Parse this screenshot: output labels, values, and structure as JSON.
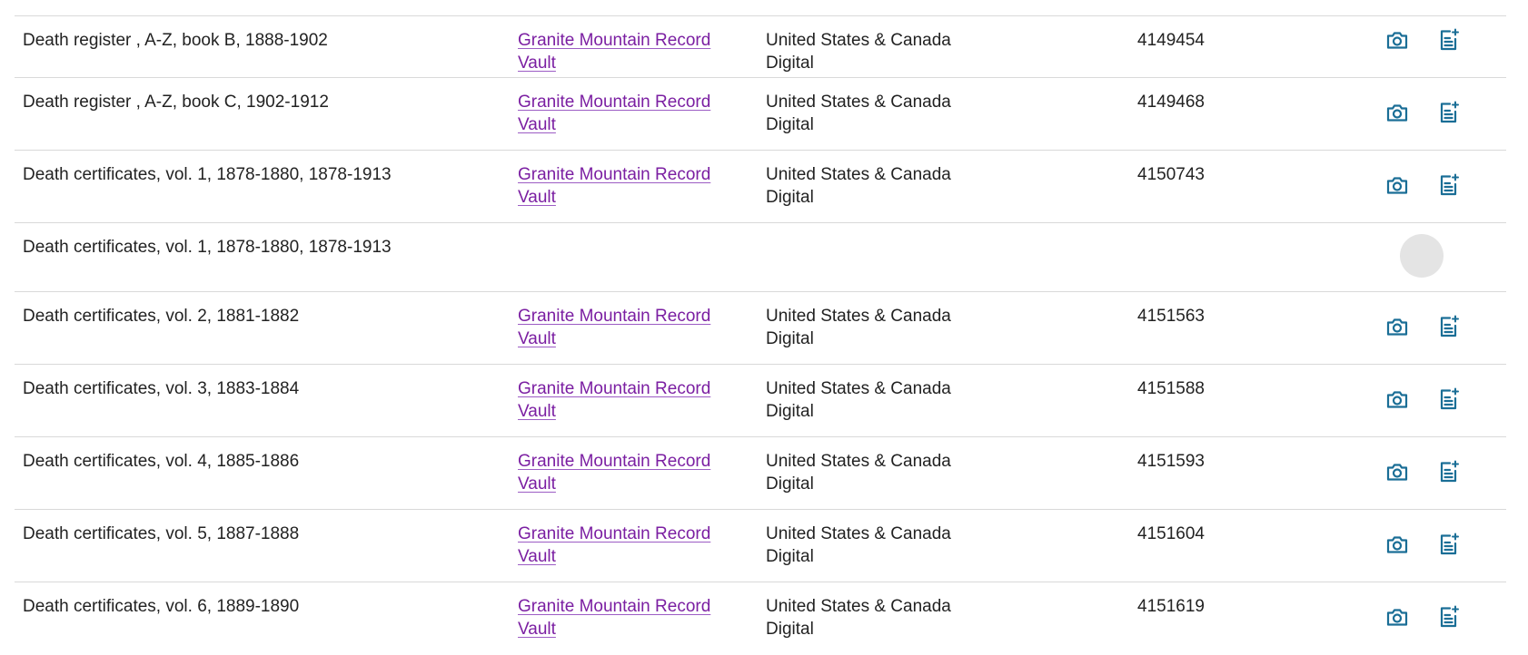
{
  "colors": {
    "link": "#7b1fa2",
    "icon": "#1a6e96",
    "divider": "#d9d9d9",
    "loading": "#e4e4e4"
  },
  "rows": [
    {
      "title": "Death register , A-Z, book B, 1888-1902",
      "location_line1": "Granite Mountain Record",
      "location_line2": "Vault",
      "region_line1": "United States & Canada",
      "region_line2": "Digital",
      "film": "4149454",
      "icons": [
        "camera-icon",
        "document-sparkle-icon"
      ]
    },
    {
      "title": "Death register , A-Z, book C, 1902-1912",
      "location_line1": "Granite Mountain Record",
      "location_line2": "Vault",
      "region_line1": "United States & Canada",
      "region_line2": "Digital",
      "film": "4149468",
      "icons": [
        "camera-icon",
        "document-sparkle-icon"
      ]
    },
    {
      "title": "Death certificates, vol. 1, 1878-1880, 1878-1913",
      "location_line1": "Granite Mountain Record",
      "location_line2": "Vault",
      "region_line1": "United States & Canada",
      "region_line2": "Digital",
      "film": "4150743",
      "icons": [
        "camera-icon",
        "document-sparkle-icon"
      ]
    },
    {
      "title": "Death certificates, vol. 1, 1878-1880, 1878-1913",
      "loading": true
    },
    {
      "title": "Death certificates, vol. 2, 1881-1882",
      "location_line1": "Granite Mountain Record",
      "location_line2": "Vault",
      "region_line1": "United States & Canada",
      "region_line2": "Digital",
      "film": "4151563",
      "icons": [
        "camera-icon",
        "document-sparkle-icon"
      ]
    },
    {
      "title": "Death certificates, vol. 3, 1883-1884",
      "location_line1": "Granite Mountain Record",
      "location_line2": "Vault",
      "region_line1": "United States & Canada",
      "region_line2": "Digital",
      "film": "4151588",
      "icons": [
        "camera-icon",
        "document-sparkle-icon"
      ]
    },
    {
      "title": "Death certificates, vol. 4, 1885-1886",
      "location_line1": "Granite Mountain Record",
      "location_line2": "Vault",
      "region_line1": "United States & Canada",
      "region_line2": "Digital",
      "film": "4151593",
      "icons": [
        "camera-icon",
        "document-sparkle-icon"
      ]
    },
    {
      "title": "Death certificates, vol. 5, 1887-1888",
      "location_line1": "Granite Mountain Record",
      "location_line2": "Vault",
      "region_line1": "United States & Canada",
      "region_line2": "Digital",
      "film": "4151604",
      "icons": [
        "camera-icon",
        "document-sparkle-icon"
      ]
    },
    {
      "title": "Death certificates, vol. 6, 1889-1890",
      "location_line1": "Granite Mountain Record",
      "location_line2": "Vault",
      "region_line1": "United States & Canada",
      "region_line2": "Digital",
      "film": "4151619",
      "icons": [
        "camera-icon",
        "document-sparkle-icon"
      ]
    }
  ]
}
